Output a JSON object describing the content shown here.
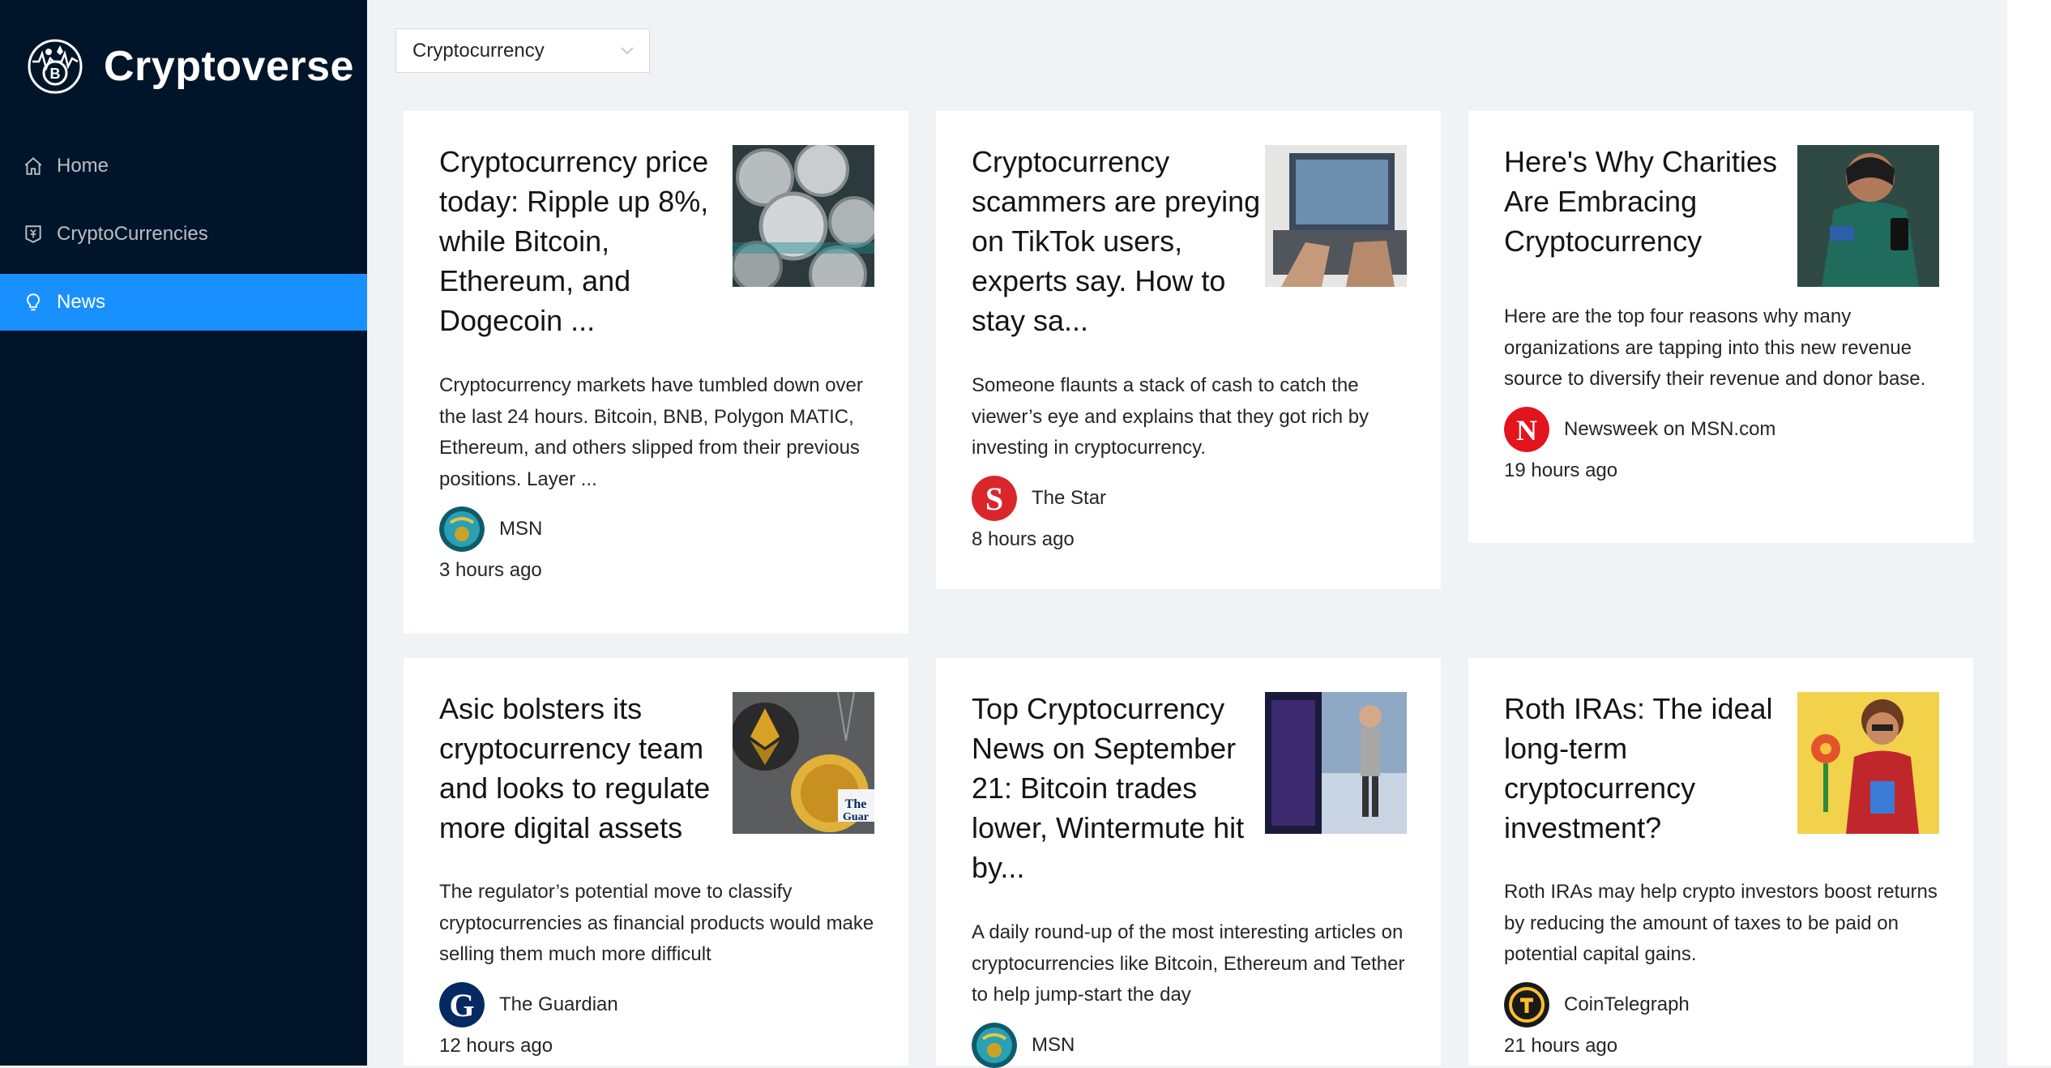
{
  "app": {
    "title": "Cryptoverse"
  },
  "sidebar": {
    "items": [
      {
        "label": "Home",
        "icon": "home-icon"
      },
      {
        "label": "CryptoCurrencies",
        "icon": "money-collect-icon"
      },
      {
        "label": "News",
        "icon": "bulb-icon",
        "active": true
      }
    ]
  },
  "filter": {
    "selected": "Cryptocurrency"
  },
  "colors": {
    "sidebar": "#001529",
    "accent": "#1890ff",
    "background": "#f0f2f5"
  },
  "news": [
    {
      "title": "Cryptocurrency price today: Ripple up 8%, while Bitcoin, Ethereum, and Dogecoin ...",
      "description": "Cryptocurrency markets have tumbled down over the last 24 hours. Bitcoin, BNB, Polygon MATIC, Ethereum, and others slipped from their previous positions. Layer ...",
      "provider": "MSN",
      "time": "3 hours ago"
    },
    {
      "title": "Cryptocurrency scammers are preying on TikTok users, experts say. How to stay sa...",
      "description": "Someone flaunts a stack of cash to catch the viewer’s eye and explains that they got rich by investing in cryptocurrency.",
      "provider": "The Star",
      "time": "8 hours ago"
    },
    {
      "title": "Here's Why Charities Are Embracing Cryptocurrency",
      "description": "Here are the top four reasons why many organizations are tapping into this new revenue source to diversify their revenue and donor base.",
      "provider": "Newsweek on MSN.com",
      "time": "19 hours ago"
    },
    {
      "title": "Asic bolsters its cryptocurrency team and looks to regulate more digital assets",
      "description": "The regulator’s potential move to classify cryptocurrencies as financial products would make selling them much more difficult",
      "provider": "The Guardian",
      "time": "12 hours ago"
    },
    {
      "title": "Top Cryptocurrency News on September 21: Bitcoin trades lower, Wintermute hit by...",
      "description": "A daily round-up of the most interesting articles on cryptocurrencies like Bitcoin, Ethereum and Tether to help jump-start the day",
      "provider": "MSN",
      "time": ""
    },
    {
      "title": "Roth IRAs: The ideal long-term cryptocurrency investment?",
      "description": "Roth IRAs may help crypto investors boost returns by reducing the amount of taxes to be paid on potential capital gains.",
      "provider": "CoinTelegraph",
      "time": "21 hours ago"
    }
  ]
}
